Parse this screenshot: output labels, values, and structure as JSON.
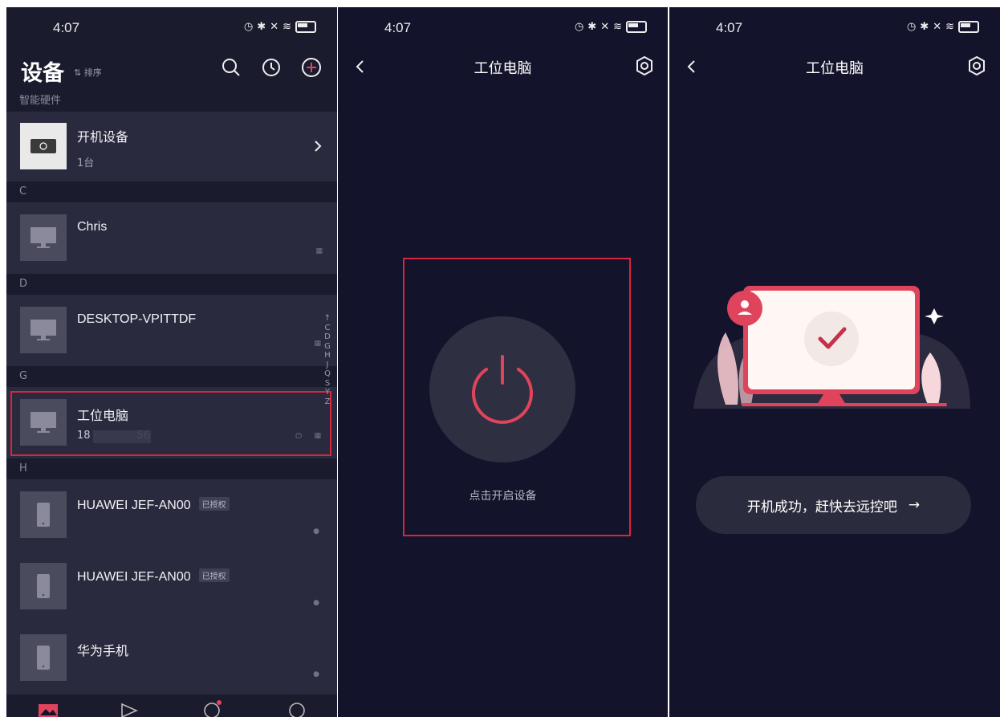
{
  "status": {
    "time": "4:07"
  },
  "devices_screen": {
    "title": "设备",
    "sort_label": "⇅ 排序",
    "sections": {
      "smart_hw": "智能硬件",
      "c": "C",
      "d": "D",
      "g": "G",
      "h": "H"
    },
    "items": [
      {
        "name": "开机设备",
        "sub": "1台"
      },
      {
        "name": "Chris",
        "sub": ""
      },
      {
        "name": "DESKTOP-VPITTDF",
        "sub": ""
      },
      {
        "name": "工位电脑",
        "sub": "18              56"
      },
      {
        "name": "HUAWEI JEF-AN00",
        "tag": "已授权"
      },
      {
        "name": "HUAWEI JEF-AN00",
        "tag": "已授权"
      },
      {
        "name": "华为手机"
      }
    ],
    "alpha_index": [
      "↑",
      "C",
      "D",
      "G",
      "H",
      "J",
      "Q",
      "S",
      "Y",
      "Z"
    ]
  },
  "power_screen": {
    "title": "工位电脑",
    "hint": "点击开启设备"
  },
  "success_screen": {
    "title": "工位电脑",
    "button": "开机成功，赶快去远控吧",
    "button_arrow": "→"
  },
  "colors": {
    "accent": "#e0445c",
    "bg": "#13132b",
    "row": "#2a2a3f",
    "highlight": "#d7263d"
  }
}
